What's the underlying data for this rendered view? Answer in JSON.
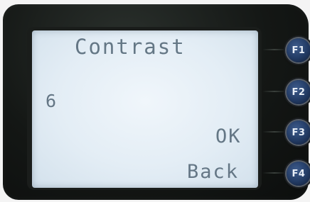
{
  "display": {
    "title": "Contrast",
    "value": "6",
    "option_ok": "OK",
    "option_back": "Back"
  },
  "keys": [
    {
      "label": "F1"
    },
    {
      "label": "F2"
    },
    {
      "label": "F3"
    },
    {
      "label": "F4"
    }
  ],
  "colors": {
    "lcd_background": "#e6eff6",
    "lcd_text": "#5a6d7c",
    "key_blue": "#223a63",
    "housing": "#141715"
  }
}
